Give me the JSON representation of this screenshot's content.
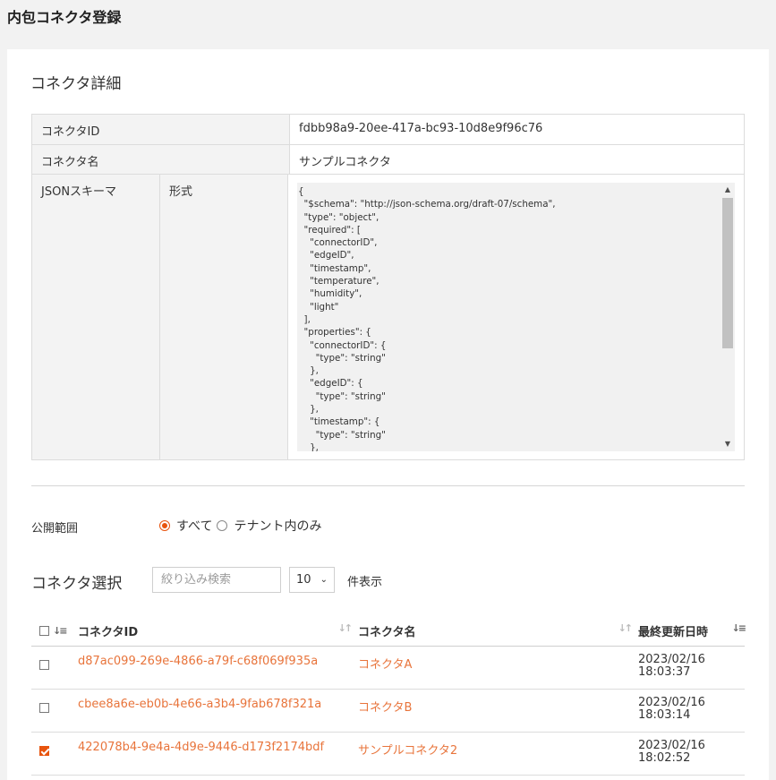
{
  "page_title": "内包コネクタ登録",
  "detail": {
    "section_title": "コネクタ詳細",
    "connector_id_label": "コネクタID",
    "connector_id_value": "fdbb98a9-20ee-417a-bc93-10d8e9f96c76",
    "connector_name_label": "コネクタ名",
    "connector_name_value": "サンプルコネクタ",
    "schema_label": "JSONスキーマ",
    "schema_sub_label": "形式",
    "schema_text": "{\n  \"$schema\": \"http://json-schema.org/draft-07/schema\",\n  \"type\": \"object\",\n  \"required\": [\n    \"connectorID\",\n    \"edgeID\",\n    \"timestamp\",\n    \"temperature\",\n    \"humidity\",\n    \"light\"\n  ],\n  \"properties\": {\n    \"connectorID\": {\n      \"type\": \"string\"\n    },\n    \"edgeID\": {\n      \"type\": \"string\"\n    },\n    \"timestamp\": {\n      \"type\": \"string\"\n    },"
  },
  "scope": {
    "label": "公開範囲",
    "options": [
      {
        "label": "すべて",
        "selected": true
      },
      {
        "label": "テナント内のみ",
        "selected": false
      }
    ]
  },
  "connector_select": {
    "title": "コネクタ選択",
    "filter_placeholder": "絞り込み検索",
    "page_size": "10",
    "page_size_suffix": "件表示",
    "columns": {
      "id": "コネクタID",
      "name": "コネクタ名",
      "updated": "最終更新日時"
    },
    "rows": [
      {
        "id": "d87ac099-269e-4866-a79f-c68f069f935a",
        "name": "コネクタA",
        "date": "2023/02/16",
        "time": "18:03:37",
        "checked": false
      },
      {
        "id": "cbee8a6e-eb0b-4e66-a3b4-9fab678f321a",
        "name": "コネクタB",
        "date": "2023/02/16",
        "time": "18:03:14",
        "checked": false
      },
      {
        "id": "422078b4-9e4a-4d9e-9446-d173f2174bdf",
        "name": "サンプルコネクタ2",
        "date": "2023/02/16",
        "time": "18:02:52",
        "checked": true
      }
    ]
  },
  "colors": {
    "accent": "#e8540e",
    "link": "#e8743b"
  }
}
